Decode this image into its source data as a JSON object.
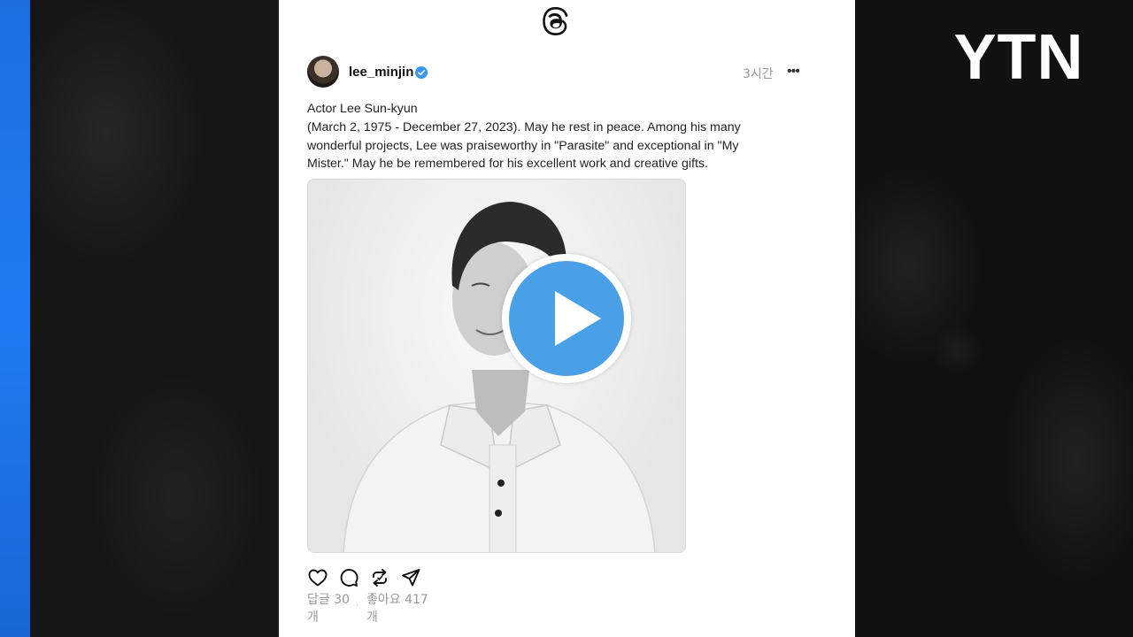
{
  "app": {
    "name": "Threads",
    "broadcaster_logo": "YTN"
  },
  "post": {
    "author": {
      "username": "lee_minjin",
      "verified": true,
      "avatar": "avatar"
    },
    "timestamp": "3시간",
    "more_icon": "more-horizontal-icon",
    "caption_lines": [
      "Actor Lee Sun-kyun",
      "(March 2, 1975 - December 27, 2023). May he rest in peace. Among his many",
      "wonderful projects, Lee was praiseworthy in \"Parasite\" and exceptional in \"My",
      "Mister.\" May he be remembered for his excellent work and creative gifts."
    ],
    "media": {
      "type": "video",
      "play_icon": "play-icon"
    },
    "actions": [
      {
        "name": "like",
        "icon": "heart-icon"
      },
      {
        "name": "reply",
        "icon": "comment-icon"
      },
      {
        "name": "repost",
        "icon": "repost-icon"
      },
      {
        "name": "share",
        "icon": "send-icon"
      }
    ],
    "stats": {
      "replies_label": "답글 30",
      "replies_unit": "개",
      "likes_label": "좋아요 417",
      "likes_unit": "개",
      "separator": "·"
    }
  },
  "colors": {
    "verified": "#3897f0",
    "play_button": "#4aa0e6",
    "accent_strip": "#1f7bf2"
  }
}
